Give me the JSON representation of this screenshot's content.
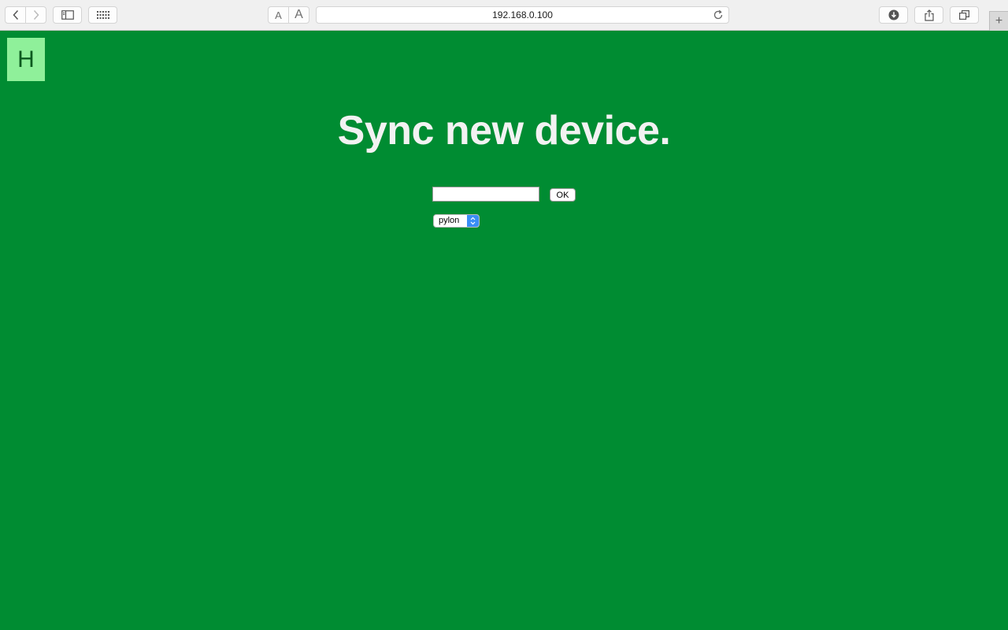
{
  "browser": {
    "url": "192.168.0.100",
    "font_small_label": "A",
    "font_large_label": "A",
    "new_tab_label": "+"
  },
  "page": {
    "logo_letter": "H",
    "title": "Sync new device.",
    "device_input_value": "",
    "ok_label": "OK",
    "select_value": "pylon"
  },
  "colors": {
    "page_background": "#008c32",
    "logo_background": "#8ff09a",
    "select_accent": "#3a8ff5"
  }
}
